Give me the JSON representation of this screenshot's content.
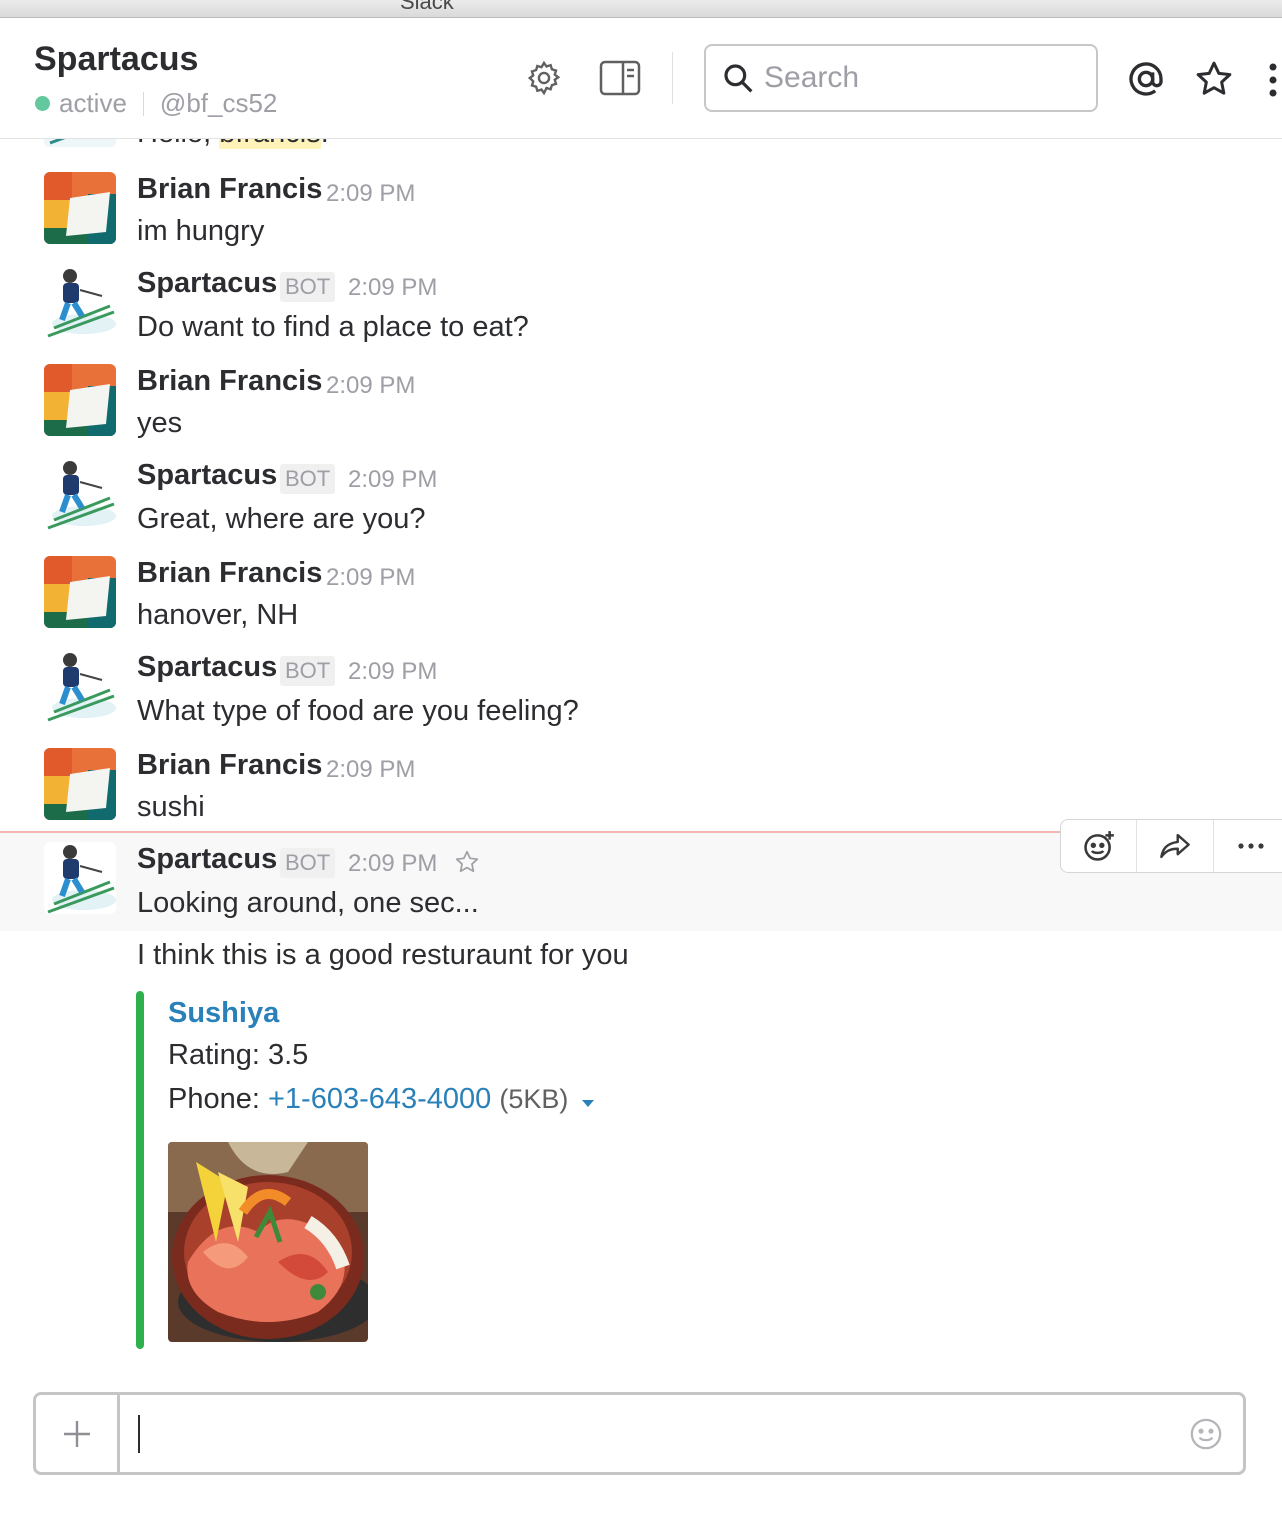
{
  "window": {
    "title": "Slack"
  },
  "header": {
    "channel_name": "Spartacus",
    "status": "active",
    "handle": "@bf_cs52",
    "search_placeholder": "Search"
  },
  "colors": {
    "accent_link": "#2a80b9",
    "attachment_bar": "#2eb14d",
    "presence": "#2fb67c",
    "new_message_line": "#f4b6b3"
  },
  "icons": [
    "gear-icon",
    "sidebar-toggle-icon",
    "search-icon",
    "at-icon",
    "star-icon",
    "more-vertical-icon",
    "add-reaction-icon",
    "share-icon",
    "more-horizontal-icon",
    "plus-icon",
    "emoji-icon"
  ],
  "messages": [
    {
      "partial_prefix": "Hello, ",
      "partial_mention": "bfrancis",
      "partial_suffix": "!"
    },
    {
      "user": "Brian Francis",
      "time": "2:09 PM",
      "text": "im hungry"
    },
    {
      "user": "Spartacus",
      "bot": "BOT",
      "time": "2:09 PM",
      "text": "Do want to find a place to eat?"
    },
    {
      "user": "Brian Francis",
      "time": "2:09 PM",
      "text": "yes"
    },
    {
      "user": "Spartacus",
      "bot": "BOT",
      "time": "2:09 PM",
      "text": "Great, where are you?"
    },
    {
      "user": "Brian Francis",
      "time": "2:09 PM",
      "text": "hanover, NH"
    },
    {
      "user": "Spartacus",
      "bot": "BOT",
      "time": "2:09 PM",
      "text": "What type of food are you feeling?"
    },
    {
      "user": "Brian Francis",
      "time": "2:09 PM",
      "text": "sushi"
    },
    {
      "user": "Spartacus",
      "bot": "BOT",
      "time": "2:09 PM",
      "text": "Looking around, one sec...",
      "followup": "I think this is a good resturaunt for you"
    }
  ],
  "attachment": {
    "title": "Sushiya",
    "rating_label": "Rating: 3.5",
    "phone_label": "Phone: ",
    "phone": "+1-603-643-4000",
    "size": "(5KB)",
    "image_alt": "sushi bowl"
  }
}
